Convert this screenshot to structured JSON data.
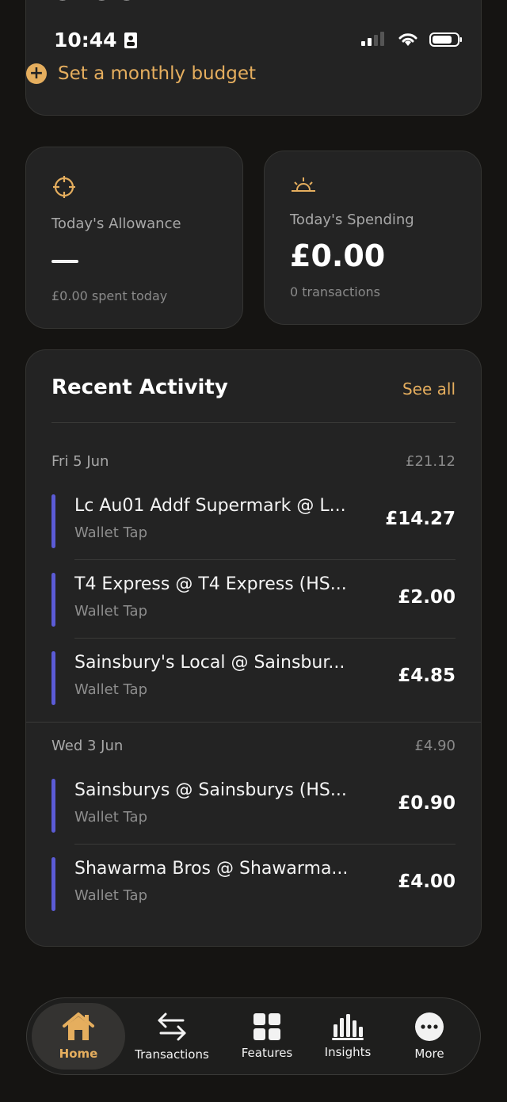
{
  "status": {
    "time": "10:44"
  },
  "budget": {
    "amount_partial": "£0.00",
    "set_budget_label": "Set a monthly budget"
  },
  "allowance": {
    "title": "Today's Allowance",
    "sub": "£0.00 spent today"
  },
  "spending": {
    "title": "Today's Spending",
    "value": "£0.00",
    "sub": "0 transactions"
  },
  "activity": {
    "title": "Recent Activity",
    "see_all": "See all",
    "days": [
      {
        "label": "Fri 5 Jun",
        "total": "£21.12",
        "transactions": [
          {
            "name": "Lc Au01 Addf Supermark @ L...",
            "method": "Wallet Tap",
            "amount": "£14.27"
          },
          {
            "name": "T4 Express @ T4 Express (HS...",
            "method": "Wallet Tap",
            "amount": "£2.00"
          },
          {
            "name": "Sainsbury's Local @ Sainsbur...",
            "method": "Wallet Tap",
            "amount": "£4.85"
          }
        ]
      },
      {
        "label": "Wed 3 Jun",
        "total": "£4.90",
        "transactions": [
          {
            "name": "Sainsburys @ Sainsburys (HS...",
            "method": "Wallet Tap",
            "amount": "£0.90"
          },
          {
            "name": "Shawarma Bros @ Shawarma...",
            "method": "Wallet Tap",
            "amount": "£4.00"
          }
        ]
      }
    ]
  },
  "nav": {
    "items": [
      {
        "label": "Home",
        "icon": "house-icon"
      },
      {
        "label": "Transactions",
        "icon": "arrows-swap-icon"
      },
      {
        "label": "Features",
        "icon": "grid-icon"
      },
      {
        "label": "Insights",
        "icon": "bar-chart-icon"
      },
      {
        "label": "More",
        "icon": "more-dots-icon"
      }
    ]
  },
  "colors": {
    "accent": "#e5ae5e",
    "tx_bar": "#5b5bd6",
    "card": "#232323",
    "background": "#151412"
  }
}
